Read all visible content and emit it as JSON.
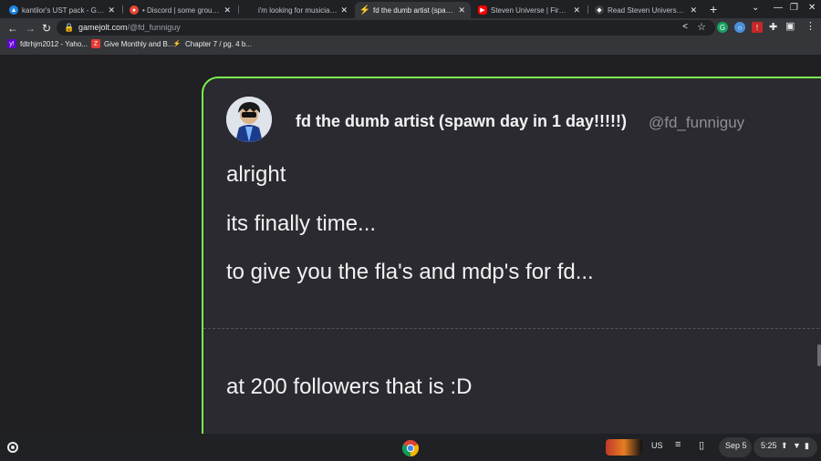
{
  "tabs": [
    {
      "title": "kantilor's UST pack - Google",
      "icon": "google-drive-icon",
      "color": "#1e88e5"
    },
    {
      "title": "• Discord | some group chat",
      "icon": "discord-icon",
      "color": "#ea4335"
    },
    {
      "title": "i'm looking for musicians, a",
      "icon": "blank-page-icon",
      "color": "#202124"
    },
    {
      "title": "fd the dumb artist (spawn d",
      "icon": "gamejolt-icon",
      "color": "#7af34c"
    },
    {
      "title": "Steven Universe | Fire Salt D",
      "icon": "youtube-icon",
      "color": "#ff0000"
    },
    {
      "title": "Read Steven Universe : The",
      "icon": "webtoon-icon",
      "color": "#3c4043"
    }
  ],
  "tab_close": "✕",
  "new_tab": "+",
  "url": {
    "domain": "gamejolt.com",
    "path": "/@fd_funniguy"
  },
  "bookmarks": [
    {
      "label": "fdtrhjm2012 - Yaho...",
      "icon": "yahoo-icon",
      "color": "#6001d2",
      "glyph": "y!"
    },
    {
      "label": "Give Monthly and B...",
      "icon": "patreon-icon",
      "color": "#e53935",
      "glyph": "Z"
    },
    {
      "label": "Chapter 7 / pg. 4 b...",
      "icon": "gamejolt-icon",
      "color": "#35363a",
      "glyph": "⚡"
    }
  ],
  "post": {
    "display_name": "fd the dumb artist (spawn day in 1 day!!!!!)",
    "handle": "@fd_funniguy",
    "lines": [
      "alright",
      "its finally time...",
      "to give you the fla's and mdp's for fd...",
      "at 200 followers that is :D"
    ],
    "accent_color": "#7af34c"
  },
  "shelf": {
    "ime": "US",
    "date": "Sep 5",
    "time": "5:25"
  }
}
